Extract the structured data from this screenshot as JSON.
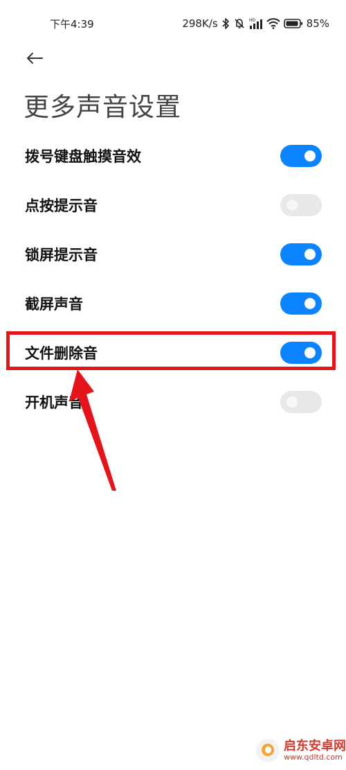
{
  "status_bar": {
    "time": "下午4:39",
    "net_speed": "298K/s",
    "battery": "85%",
    "icons": [
      "bluetooth-icon",
      "mute-bell-icon",
      "hd-signal-icon",
      "wifi-icon",
      "battery-icon"
    ]
  },
  "header": {
    "back_icon": "arrow-left-icon",
    "title": "更多声音设置"
  },
  "settings": [
    {
      "label": "拨号键盘触摸音效",
      "enabled": true
    },
    {
      "label": "点按提示音",
      "enabled": false
    },
    {
      "label": "锁屏提示音",
      "enabled": true
    },
    {
      "label": "截屏声音",
      "enabled": true
    },
    {
      "label": "文件删除音",
      "enabled": true
    },
    {
      "label": "开机声音",
      "enabled": false
    }
  ],
  "annotation": {
    "highlighted_item": "文件删除音",
    "color": "#e5141b"
  },
  "watermark": {
    "name": "启东安卓网",
    "url": "www.qdltd.com"
  },
  "colors": {
    "toggle_on": "#0d84ff",
    "toggle_off": "#e8e8e8",
    "title": "#444444"
  }
}
